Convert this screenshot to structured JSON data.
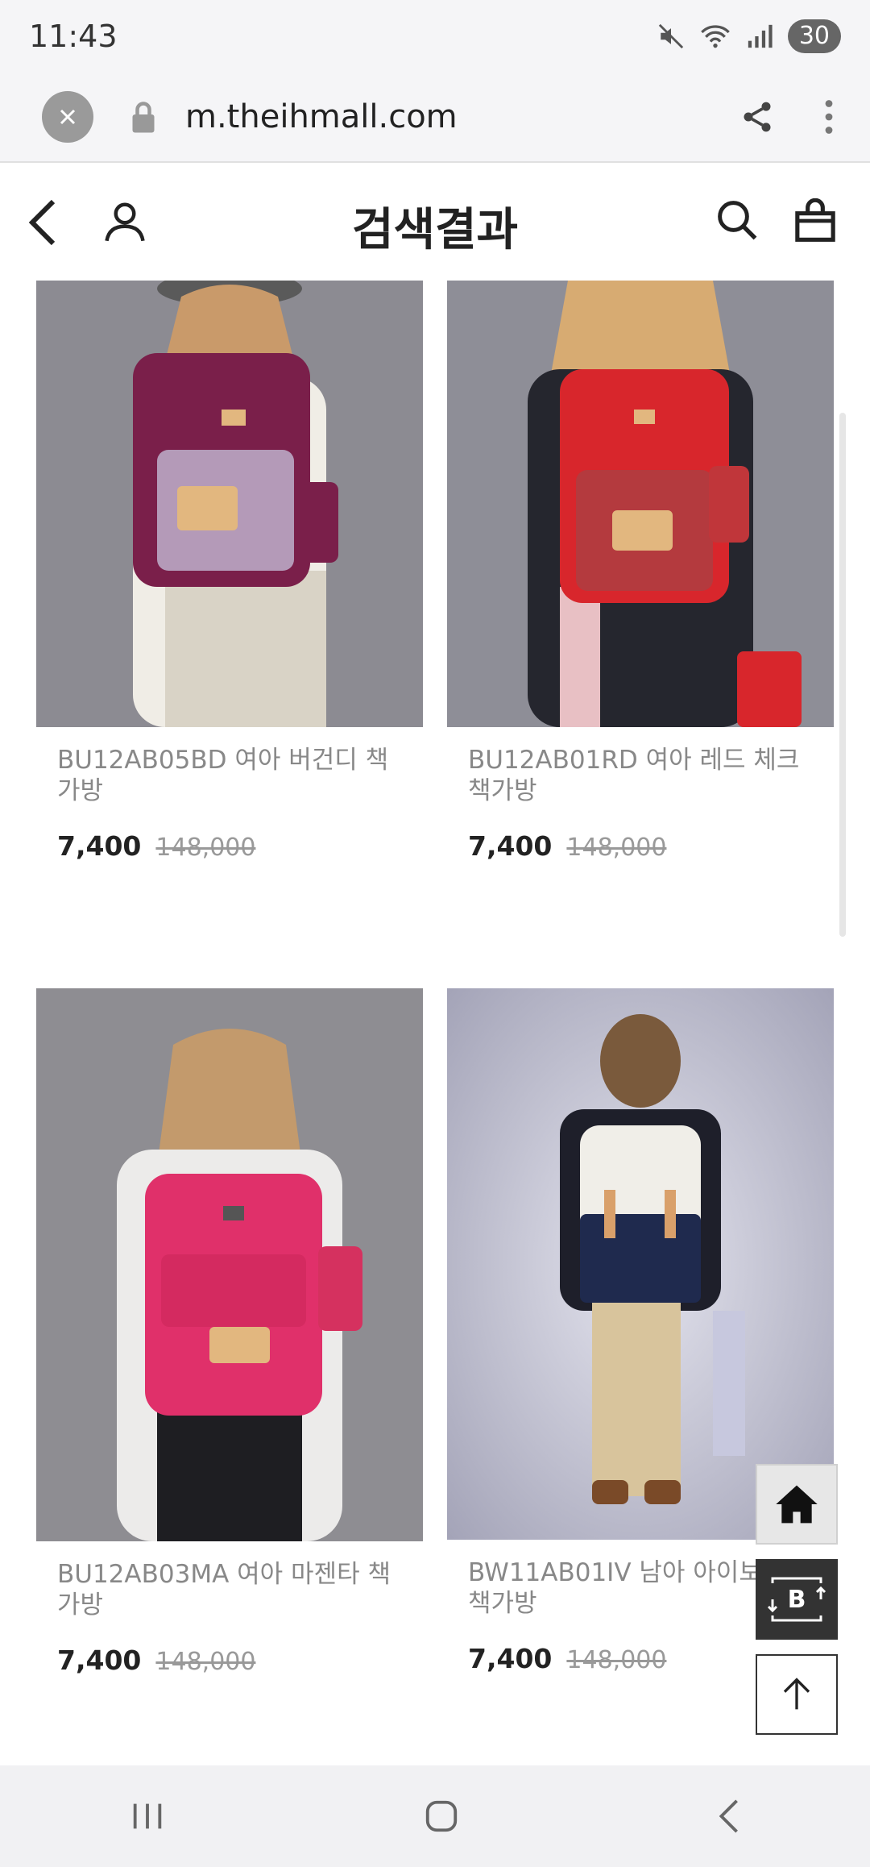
{
  "status": {
    "time": "11:43",
    "battery": "30"
  },
  "browser": {
    "url": "m.theihmall.com"
  },
  "header": {
    "title": "검색결과"
  },
  "products": [
    {
      "name": "BU12AB05BD 여아 버건디 책가방",
      "price": "7,400",
      "original_price": "148,000",
      "bag_color": "#7a1f4a",
      "pattern": "houndstooth-purple"
    },
    {
      "name": "BU12AB01RD 여아 레드 체크 책가방",
      "price": "7,400",
      "original_price": "148,000",
      "bag_color": "#d8262c",
      "pattern": "check-red"
    },
    {
      "name": "BU12AB03MA 여아 마젠타 책가방",
      "price": "7,400",
      "original_price": "148,000",
      "bag_color": "#e0306a",
      "pattern": "solid-magenta"
    },
    {
      "name": "BW11AB01IV 남아 아이보리 책가방",
      "price": "7,400",
      "original_price": "148,000",
      "bag_color": "#f0eee8",
      "pattern": "ivory-navy"
    }
  ],
  "floating": {
    "b_label": "B"
  },
  "icons": {
    "close": "close-icon",
    "lock": "lock-icon",
    "share": "share-icon",
    "more": "kebab-icon",
    "back": "back-icon",
    "user": "user-icon",
    "search": "search-icon",
    "cart": "cart-icon",
    "home": "home-icon",
    "top": "arrow-up-icon"
  }
}
